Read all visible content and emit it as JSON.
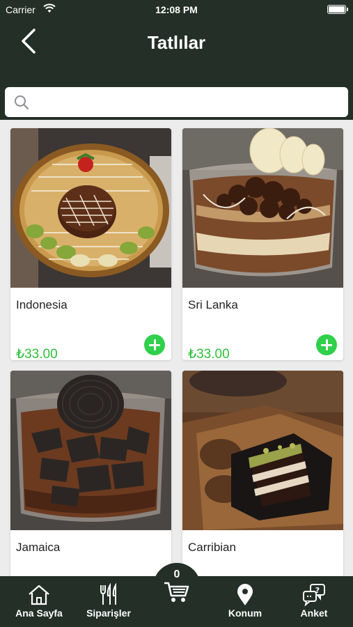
{
  "status_bar": {
    "carrier": "Carrier",
    "time": "12:08 PM"
  },
  "header": {
    "title": "Tatlılar"
  },
  "search": {
    "placeholder": ""
  },
  "products": [
    {
      "name": "Indonesia",
      "price": "₺33.00"
    },
    {
      "name": "Sri Lanka",
      "price": "₺33.00"
    },
    {
      "name": "Jamaica",
      "price": ""
    },
    {
      "name": "Carribian",
      "price": ""
    }
  ],
  "cart": {
    "count": "0"
  },
  "tabs": [
    {
      "label": "Ana Sayfa",
      "icon": "home-icon"
    },
    {
      "label": "Siparişler",
      "icon": "fork-knife-icon"
    },
    {
      "label": "Konum",
      "icon": "location-pin-icon"
    },
    {
      "label": "Anket",
      "icon": "chat-question-icon"
    }
  ],
  "colors": {
    "header_bg": "#232f27",
    "price": "#2fbf3a",
    "add_button": "#2fd14a"
  }
}
